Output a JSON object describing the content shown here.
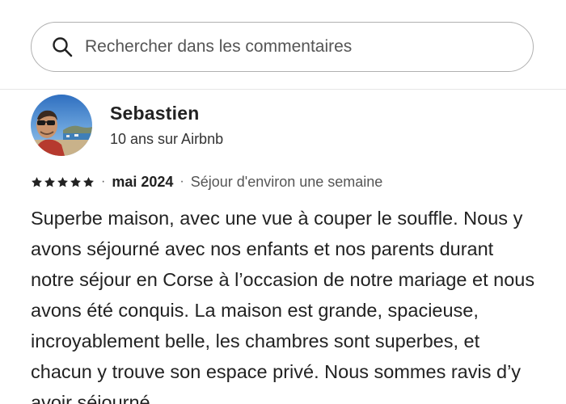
{
  "search": {
    "placeholder": "Rechercher dans les commentaires",
    "value": ""
  },
  "review": {
    "reviewer_name": "Sebastien",
    "reviewer_tenure": "10 ans sur Airbnb",
    "rating": 5,
    "rating_max": 5,
    "separator": "·",
    "date": "mai 2024",
    "stay": "Séjour d'environ une semaine",
    "text": "Superbe maison, avec une vue à couper le souffle. Nous y avons séjourné avec nos enfants et nos parents durant notre séjour en Corse à l’occasion de notre mariage et nous avons été conquis. La maison est grande, spacieuse, incroyablement belle, les chambres sont superbes, et chacun y trouve son espace privé. Nous sommes ravis d’y avoir séjourné"
  },
  "icons": {
    "search": "search-icon",
    "star": "star-icon",
    "avatar": "avatar"
  },
  "colors": {
    "text_primary": "#222222",
    "text_secondary": "#555555",
    "border": "#b0b0b0",
    "divider": "#e6e6e6"
  }
}
